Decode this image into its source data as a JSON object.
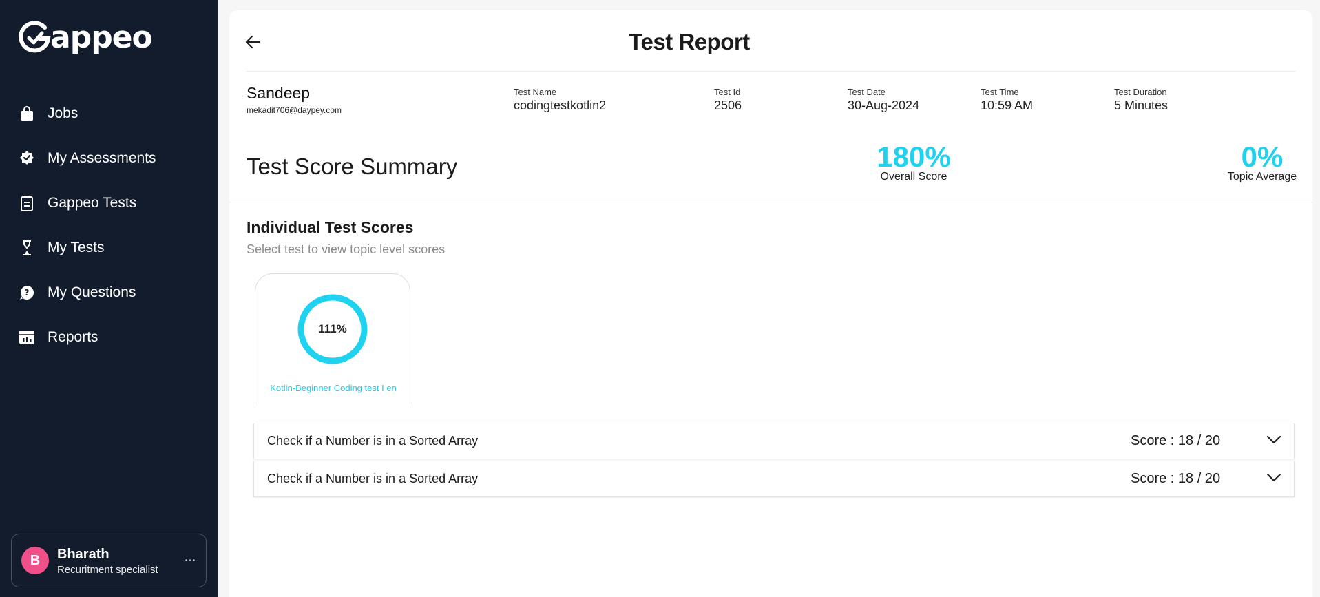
{
  "app": {
    "name": "Gappeo"
  },
  "sidebar": {
    "items": [
      {
        "label": "Jobs",
        "icon": "shopping-bag-icon"
      },
      {
        "label": "My Assessments",
        "icon": "verified-badge-icon"
      },
      {
        "label": "Gappeo Tests",
        "icon": "clipboard-icon"
      },
      {
        "label": "My Tests",
        "icon": "hourglass-icon"
      },
      {
        "label": "My Questions",
        "icon": "help-bubble-icon"
      },
      {
        "label": "Reports",
        "icon": "report-chart-icon"
      }
    ]
  },
  "user": {
    "initial": "B",
    "name": "Bharath",
    "role": "Recuritment specialist",
    "more": "···"
  },
  "header": {
    "title": "Test Report"
  },
  "candidate": {
    "name": "Sandeep",
    "email": "mekadit706@daypey.com"
  },
  "meta": {
    "test_name": {
      "label": "Test Name",
      "value": "codingtestkotlin2"
    },
    "test_id": {
      "label": "Test Id",
      "value": "2506"
    },
    "test_date": {
      "label": "Test Date",
      "value": "30-Aug-2024"
    },
    "test_time": {
      "label": "Test Time",
      "value": "10:59 AM"
    },
    "test_duration": {
      "label": "Test Duration",
      "value": "5 Minutes"
    }
  },
  "summary": {
    "title": "Test Score Summary",
    "overall": {
      "value": "180%",
      "label": "Overall Score"
    },
    "topic": {
      "value": "0%",
      "label": "Topic Average"
    }
  },
  "individual": {
    "title": "Individual Test Scores",
    "subtitle": "Select test to view topic level scores",
    "tests": [
      {
        "percent": "111%",
        "name": "Kotlin-Beginner Coding test I en"
      }
    ]
  },
  "questions": [
    {
      "title": "Check if a Number is in a Sorted Array",
      "score": "Score : 18 / 20"
    },
    {
      "title": "Check if a Number is in a Sorted Array",
      "score": "Score : 18 / 20"
    }
  ],
  "colors": {
    "sidebar_bg": "#131c2d",
    "accent": "#1fd3f0",
    "avatar": "#f0508a"
  }
}
